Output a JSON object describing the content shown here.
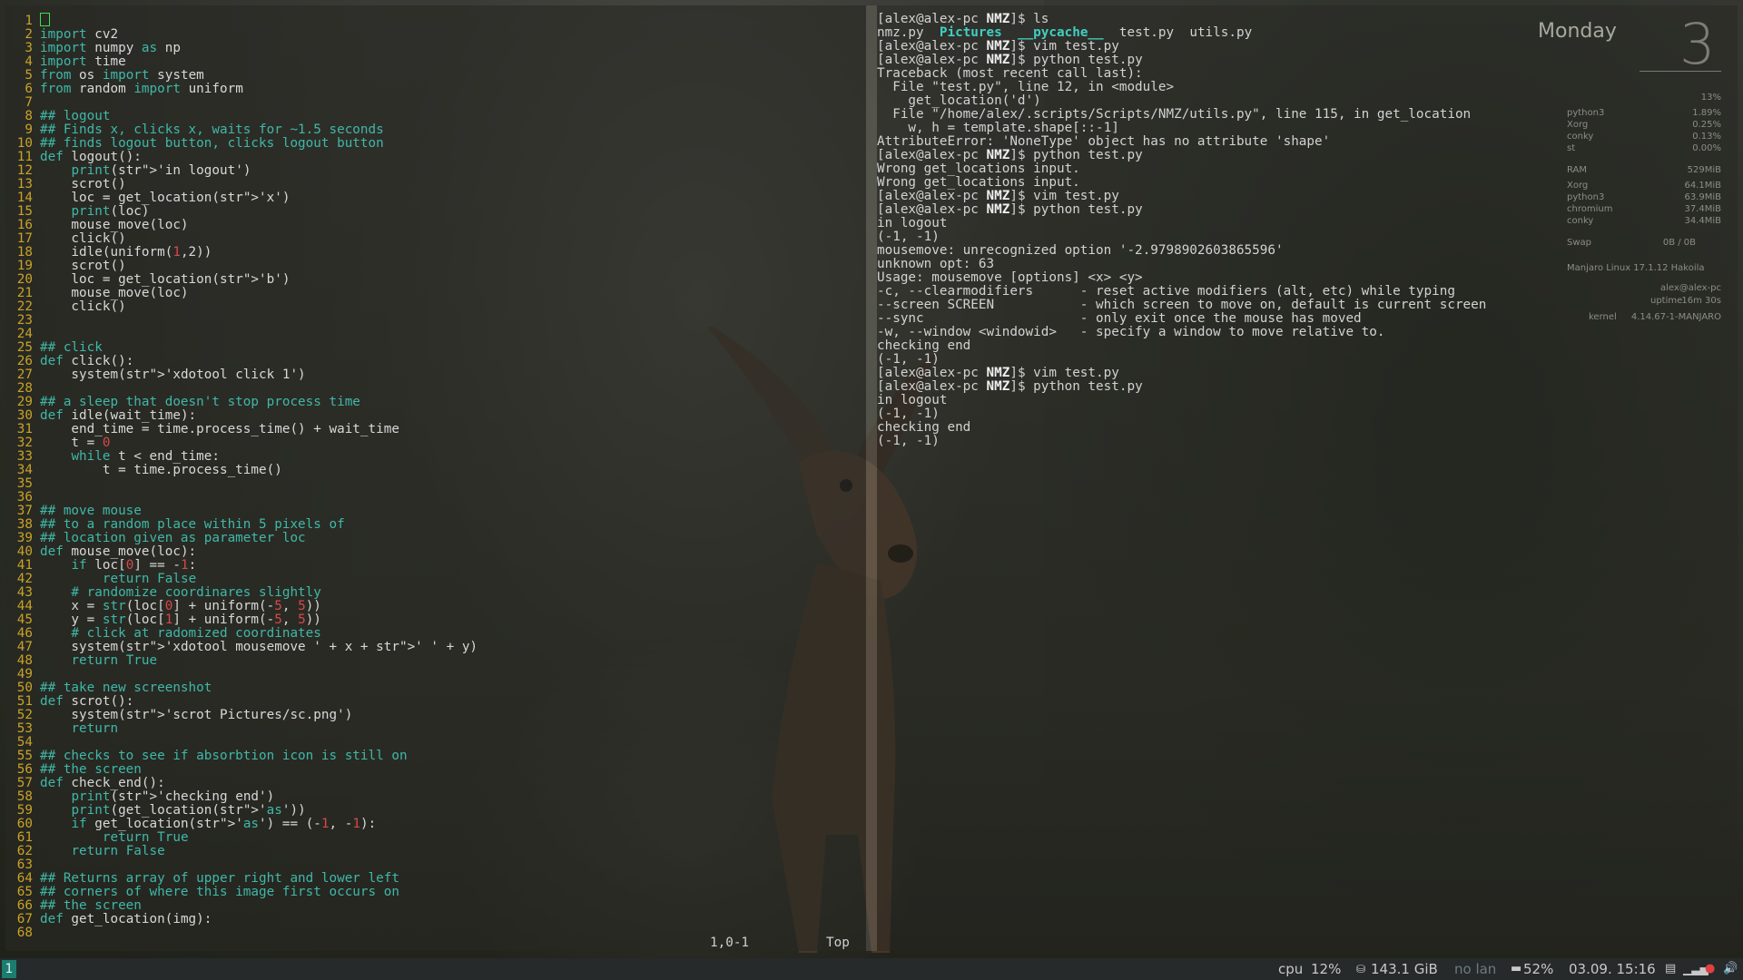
{
  "vim": {
    "lines": [
      {
        "n": "1",
        "code": ""
      },
      {
        "n": "2",
        "code": "import cv2"
      },
      {
        "n": "3",
        "code": "import numpy as np"
      },
      {
        "n": "4",
        "code": "import time"
      },
      {
        "n": "5",
        "code": "from os import system"
      },
      {
        "n": "6",
        "code": "from random import uniform"
      },
      {
        "n": "7",
        "code": ""
      },
      {
        "n": "8",
        "code": "## logout"
      },
      {
        "n": "9",
        "code": "## Finds x, clicks x, waits for ~1.5 seconds"
      },
      {
        "n": "10",
        "code": "## finds logout button, clicks logout button"
      },
      {
        "n": "11",
        "code": "def logout():"
      },
      {
        "n": "12",
        "code": "    print('in logout')"
      },
      {
        "n": "13",
        "code": "    scrot()"
      },
      {
        "n": "14",
        "code": "    loc = get_location('x')"
      },
      {
        "n": "15",
        "code": "    print(loc)"
      },
      {
        "n": "16",
        "code": "    mouse_move(loc)"
      },
      {
        "n": "17",
        "code": "    click()"
      },
      {
        "n": "18",
        "code": "    idle(uniform(1,2))"
      },
      {
        "n": "19",
        "code": "    scrot()"
      },
      {
        "n": "20",
        "code": "    loc = get_location('b')"
      },
      {
        "n": "21",
        "code": "    mouse_move(loc)"
      },
      {
        "n": "22",
        "code": "    click()"
      },
      {
        "n": "23",
        "code": ""
      },
      {
        "n": "24",
        "code": ""
      },
      {
        "n": "25",
        "code": "## click"
      },
      {
        "n": "26",
        "code": "def click():"
      },
      {
        "n": "27",
        "code": "    system('xdotool click 1')"
      },
      {
        "n": "28",
        "code": ""
      },
      {
        "n": "29",
        "code": "## a sleep that doesn't stop process time"
      },
      {
        "n": "30",
        "code": "def idle(wait_time):"
      },
      {
        "n": "31",
        "code": "    end_time = time.process_time() + wait_time"
      },
      {
        "n": "32",
        "code": "    t = 0"
      },
      {
        "n": "33",
        "code": "    while t < end_time:"
      },
      {
        "n": "34",
        "code": "        t = time.process_time()"
      },
      {
        "n": "35",
        "code": ""
      },
      {
        "n": "36",
        "code": ""
      },
      {
        "n": "37",
        "code": "## move mouse"
      },
      {
        "n": "38",
        "code": "## to a random place within 5 pixels of"
      },
      {
        "n": "39",
        "code": "## location given as parameter loc"
      },
      {
        "n": "40",
        "code": "def mouse_move(loc):"
      },
      {
        "n": "41",
        "code": "    if loc[0] == -1:"
      },
      {
        "n": "42",
        "code": "        return False"
      },
      {
        "n": "43",
        "code": "    # randomize coordinares slightly"
      },
      {
        "n": "44",
        "code": "    x = str(loc[0] + uniform(-5, 5))"
      },
      {
        "n": "45",
        "code": "    y = str(loc[1] + uniform(-5, 5))"
      },
      {
        "n": "46",
        "code": "    # click at radomized coordinates"
      },
      {
        "n": "47",
        "code": "    system('xdotool mousemove ' + x + ' ' + y)"
      },
      {
        "n": "48",
        "code": "    return True"
      },
      {
        "n": "49",
        "code": ""
      },
      {
        "n": "50",
        "code": "## take new screenshot"
      },
      {
        "n": "51",
        "code": "def scrot():"
      },
      {
        "n": "52",
        "code": "    system('scrot Pictures/sc.png')"
      },
      {
        "n": "53",
        "code": "    return"
      },
      {
        "n": "54",
        "code": ""
      },
      {
        "n": "55",
        "code": "## checks to see if absorbtion icon is still on"
      },
      {
        "n": "56",
        "code": "## the screen"
      },
      {
        "n": "57",
        "code": "def check_end():"
      },
      {
        "n": "58",
        "code": "    print('checking end')"
      },
      {
        "n": "59",
        "code": "    print(get_location('as'))"
      },
      {
        "n": "60",
        "code": "    if get_location('as') == (-1, -1):"
      },
      {
        "n": "61",
        "code": "        return True"
      },
      {
        "n": "62",
        "code": "    return False"
      },
      {
        "n": "63",
        "code": ""
      },
      {
        "n": "64",
        "code": "## Returns array of upper right and lower left"
      },
      {
        "n": "65",
        "code": "## corners of where this image first occurs on"
      },
      {
        "n": "66",
        "code": "## the screen"
      },
      {
        "n": "67",
        "code": "def get_location(img):"
      },
      {
        "n": "68",
        "code": ""
      }
    ],
    "status_position": "1,0-1",
    "status_scroll": "Top"
  },
  "terminal": {
    "lines": [
      "[alex@alex-pc NMZ]$ ls",
      "nmz.py  Pictures  __pycache__  test.py  utils.py",
      "[alex@alex-pc NMZ]$ vim test.py",
      "[alex@alex-pc NMZ]$ python test.py",
      "Traceback (most recent call last):",
      "  File \"test.py\", line 12, in <module>",
      "    get_location('d')",
      "  File \"/home/alex/.scripts/Scripts/NMZ/utils.py\", line 115, in get_location",
      "    w, h = template.shape[::-1]",
      "AttributeError: 'NoneType' object has no attribute 'shape'",
      "[alex@alex-pc NMZ]$ python test.py",
      "Wrong get_locations input.",
      "Wrong get_locations input.",
      "[alex@alex-pc NMZ]$ vim test.py",
      "[alex@alex-pc NMZ]$ python test.py",
      "in logout",
      "(-1, -1)",
      "mousemove: unrecognized option '-2.9798902603865596'",
      "unknown opt: 63",
      "Usage: mousemove [options] <x> <y>",
      "-c, --clearmodifiers      - reset active modifiers (alt, etc) while typing",
      "--screen SCREEN           - which screen to move on, default is current screen",
      "--sync                    - only exit once the mouse has moved",
      "-w, --window <windowid>   - specify a window to move relative to.",
      "checking end",
      "(-1, -1)",
      "[alex@alex-pc NMZ]$ vim test.py",
      "[alex@alex-pc NMZ]$ python test.py",
      "in logout",
      "(-1, -1)",
      "checking end",
      "(-1, -1)"
    ]
  },
  "conky": {
    "day": "Monday",
    "day_number": "3",
    "cpu_total": "13%",
    "procs": [
      {
        "name": "python3",
        "val": "1.89%"
      },
      {
        "name": "Xorg",
        "val": "0.25%"
      },
      {
        "name": "conky",
        "val": "0.13%"
      },
      {
        "name": "st",
        "val": "0.00%"
      }
    ],
    "ram_label": "RAM",
    "ram_val": "529MiB",
    "mem": [
      {
        "name": "Xorg",
        "val": "64.1MiB"
      },
      {
        "name": "python3",
        "val": "63.9MiB"
      },
      {
        "name": "chromium",
        "val": "37.4MiB"
      },
      {
        "name": "conky",
        "val": "34.4MiB"
      }
    ],
    "swap_label": "Swap",
    "swap_val": "0B / 0B",
    "os": "Manjaro Linux 17.1.12 Hakoila",
    "user": "alex@alex-pc",
    "uptime_label": "uptime",
    "uptime": "16m 30s",
    "kernel_label": "kernel",
    "kernel": "4.14.67-1-MANJARO"
  },
  "taskbar": {
    "workspace": "1",
    "cpu_label": "cpu",
    "cpu_val": "12%",
    "disk": "143.1 GiB",
    "lan": "no lan",
    "battery": "52%",
    "datetime": "03.09. 15:16"
  },
  "colors": {
    "linenr": "#c9a227",
    "comment": "#3fb8a8",
    "string": "#d44a4a",
    "workspace": "#1a7d6f"
  }
}
